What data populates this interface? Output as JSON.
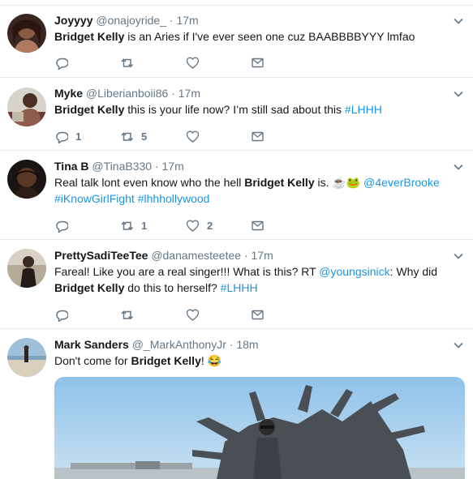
{
  "colors": {
    "link": "#1b95e0",
    "muted": "#657786",
    "text": "#14171a",
    "divider": "#e6ecf0"
  },
  "icons": {
    "reply": "reply-icon",
    "retweet": "retweet-icon",
    "like": "heart-icon",
    "dm": "envelope-icon",
    "menu": "chevron-down-icon"
  },
  "tweets": [
    {
      "name": "Joyyyy",
      "handle": "@onajoyride_",
      "dot": "·",
      "time": "17m",
      "text": {
        "bold": "Bridget Kelly",
        "rest": " is an Aries if I've ever seen one cuz BAABBBBYYY lmfao"
      },
      "retweets": "",
      "likes": ""
    },
    {
      "name": "Myke",
      "handle": "@Liberianboii86",
      "dot": "·",
      "time": "17m",
      "text": {
        "bold": "Bridget Kelly",
        "rest": " this is your life now? I’m still sad about this ",
        "tag": "#LHHH"
      },
      "replies": "1",
      "retweets": "5",
      "likes": ""
    },
    {
      "name": "Tina B",
      "handle": "@TinaB330",
      "dot": "·",
      "time": "17m",
      "text": {
        "pre": "Real talk lont even know who the hell ",
        "bold": "Bridget Kelly",
        "post": " is. ",
        "emoji1": "☕",
        "emoji2": "🐸",
        "mention": "@4everBrooke",
        "tag1": "#iKnowGirlFight",
        "tag2": "#lhhhollywood"
      },
      "replies": "",
      "retweets": "1",
      "likes": "2"
    },
    {
      "name": "PrettySadiTeeTee",
      "handle": "@danamesteetee",
      "dot": "·",
      "time": "17m",
      "text": {
        "pre": "Fareal! Like you are a real singer!!! What is this? RT ",
        "mention": "@youngsinick",
        "post": ": Why did",
        "bold": "Bridget Kelly",
        "rest": " do this to herself? ",
        "tag": "#LHHH"
      }
    },
    {
      "name": "Mark Sanders",
      "handle": "@_MarkAnthonyJr",
      "dot": "·",
      "time": "18m",
      "text": {
        "pre": "Don't come for ",
        "bold": "Bridget Kelly",
        "post": "!",
        "emoji": "😂"
      }
    }
  ]
}
